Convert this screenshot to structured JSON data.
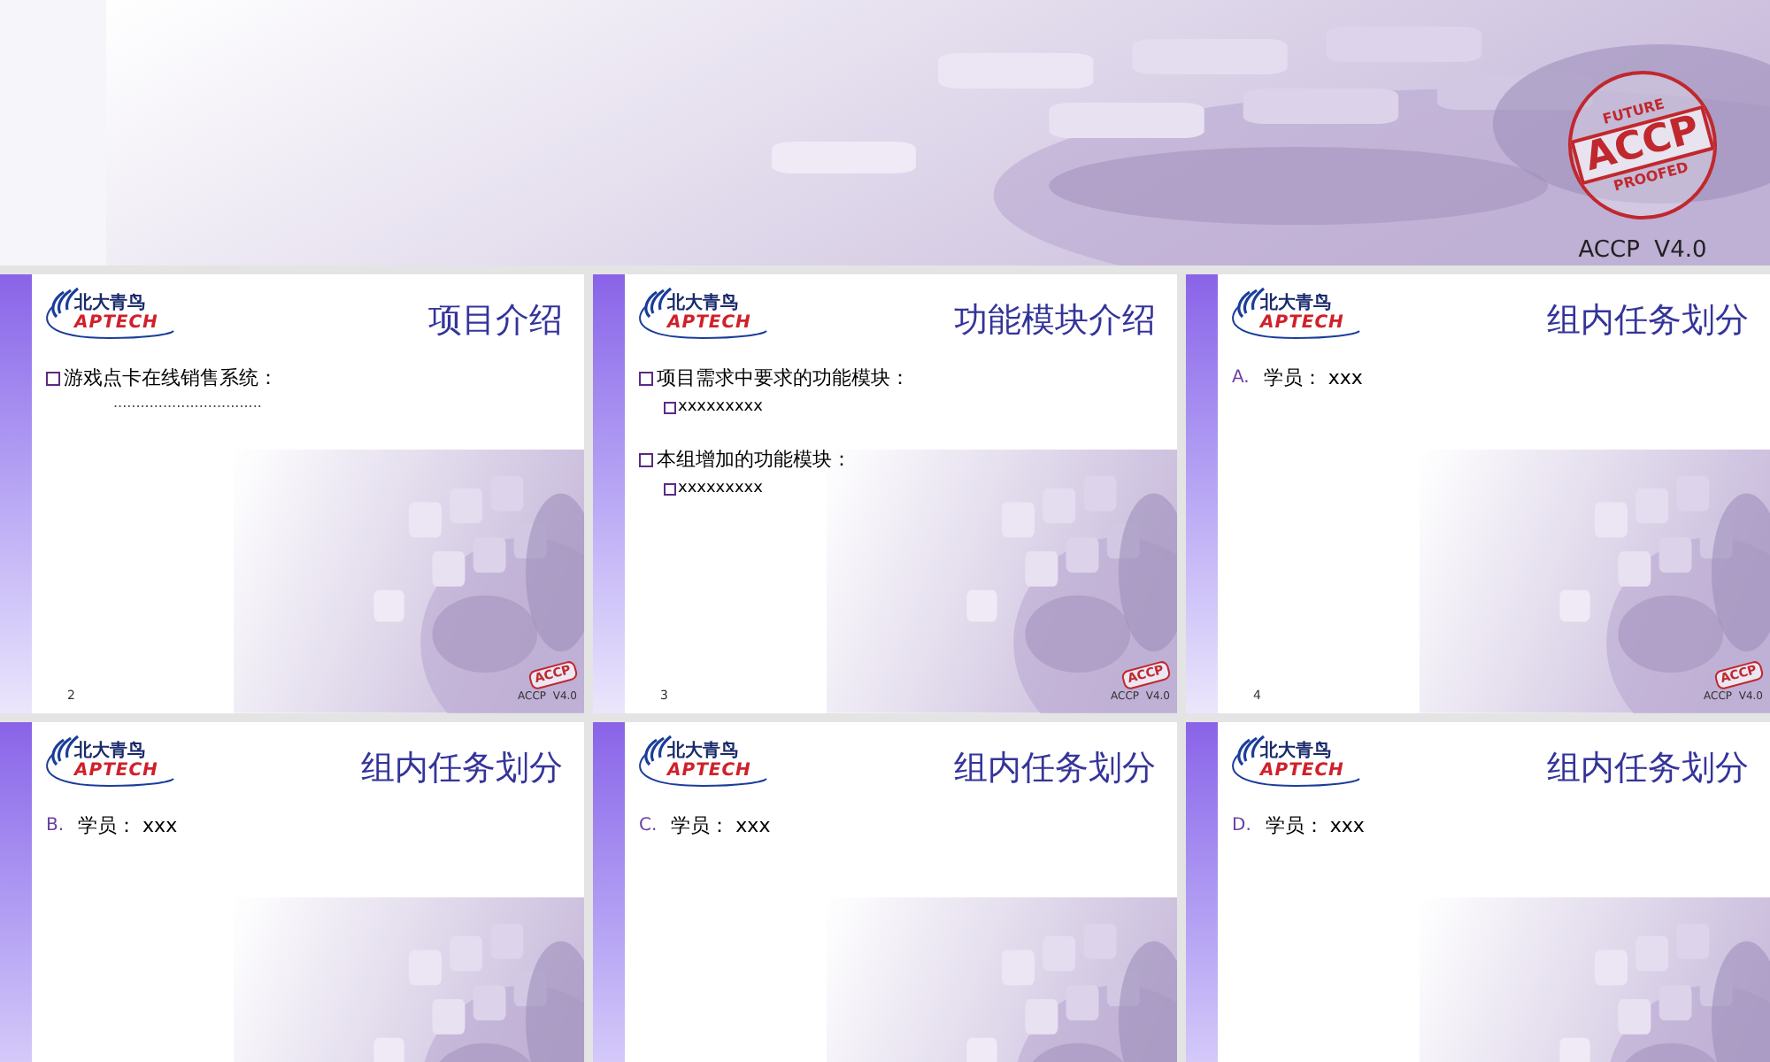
{
  "top_slide": {
    "stamp": {
      "top": "FUTURE",
      "main": "ACCP",
      "bottom": "PROOFED"
    },
    "footer": "ACCP  V4.0"
  },
  "slides": [
    {
      "logo": {
        "name": "北大青鸟",
        "brand": "APTECH"
      },
      "title": "项目介绍",
      "items": [
        {
          "kind": "square",
          "text": "游戏点卡在线销售系统：",
          "children": [
            {
              "kind": "plain",
              "text": "................................."
            }
          ]
        }
      ],
      "number": "2",
      "stamp": "ACCP",
      "footer": "ACCP  V4.0"
    },
    {
      "logo": {
        "name": "北大青鸟",
        "brand": "APTECH"
      },
      "title": "功能模块介绍",
      "items": [
        {
          "kind": "square",
          "text": "项目需求中要求的功能模块：",
          "children": [
            {
              "kind": "square",
              "text": "xxxxxxxxx"
            }
          ]
        },
        {
          "kind": "square",
          "text": "本组增加的功能模块：",
          "children": [
            {
              "kind": "square",
              "text": "xxxxxxxxx"
            }
          ]
        }
      ],
      "number": "3",
      "stamp": "ACCP",
      "footer": "ACCP  V4.0"
    },
    {
      "logo": {
        "name": "北大青鸟",
        "brand": "APTECH"
      },
      "title": "组内任务划分",
      "items": [
        {
          "kind": "lettered",
          "marker": "A.",
          "text": "学员： xxx"
        }
      ],
      "number": "4",
      "stamp": "ACCP",
      "footer": "ACCP  V4.0"
    },
    {
      "logo": {
        "name": "北大青鸟",
        "brand": "APTECH"
      },
      "title": "组内任务划分",
      "items": [
        {
          "kind": "lettered",
          "marker": "B.",
          "text": "学员： xxx"
        }
      ]
    },
    {
      "logo": {
        "name": "北大青鸟",
        "brand": "APTECH"
      },
      "title": "组内任务划分",
      "items": [
        {
          "kind": "lettered",
          "marker": "C.",
          "text": "学员： xxx"
        }
      ]
    },
    {
      "logo": {
        "name": "北大青鸟",
        "brand": "APTECH"
      },
      "title": "组内任务划分",
      "items": [
        {
          "kind": "lettered",
          "marker": "D.",
          "text": "学员： xxx"
        }
      ]
    }
  ]
}
